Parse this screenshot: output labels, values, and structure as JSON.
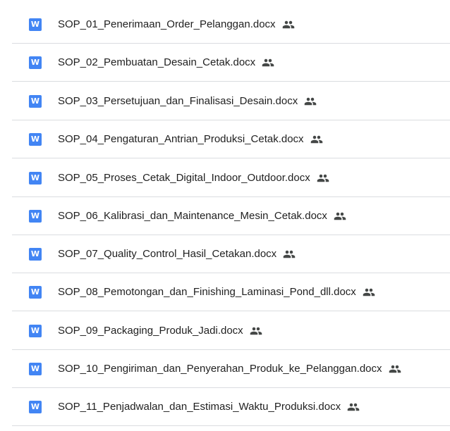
{
  "files": [
    {
      "name": "SOP_01_Penerimaan_Order_Pelanggan.docx",
      "type_icon": "word-doc-icon",
      "type_letter": "W",
      "shared": true
    },
    {
      "name": "SOP_02_Pembuatan_Desain_Cetak.docx",
      "type_icon": "word-doc-icon",
      "type_letter": "W",
      "shared": true
    },
    {
      "name": "SOP_03_Persetujuan_dan_Finalisasi_Desain.docx",
      "type_icon": "word-doc-icon",
      "type_letter": "W",
      "shared": true
    },
    {
      "name": "SOP_04_Pengaturan_Antrian_Produksi_Cetak.docx",
      "type_icon": "word-doc-icon",
      "type_letter": "W",
      "shared": true
    },
    {
      "name": "SOP_05_Proses_Cetak_Digital_Indoor_Outdoor.docx",
      "type_icon": "word-doc-icon",
      "type_letter": "W",
      "shared": true
    },
    {
      "name": "SOP_06_Kalibrasi_dan_Maintenance_Mesin_Cetak.docx",
      "type_icon": "word-doc-icon",
      "type_letter": "W",
      "shared": true
    },
    {
      "name": "SOP_07_Quality_Control_Hasil_Cetakan.docx",
      "type_icon": "word-doc-icon",
      "type_letter": "W",
      "shared": true
    },
    {
      "name": "SOP_08_Pemotongan_dan_Finishing_Laminasi_Pond_dll.docx",
      "type_icon": "word-doc-icon",
      "type_letter": "W",
      "shared": true
    },
    {
      "name": "SOP_09_Packaging_Produk_Jadi.docx",
      "type_icon": "word-doc-icon",
      "type_letter": "W",
      "shared": true
    },
    {
      "name": "SOP_10_Pengiriman_dan_Penyerahan_Produk_ke_Pelanggan.docx",
      "type_icon": "word-doc-icon",
      "type_letter": "W",
      "shared": true
    },
    {
      "name": "SOP_11_Penjadwalan_dan_Estimasi_Waktu_Produksi.docx",
      "type_icon": "word-doc-icon",
      "type_letter": "W",
      "shared": true
    }
  ],
  "colors": {
    "doc_icon": "#4285f4",
    "text": "#1f1f1f",
    "shared_icon": "#444746",
    "divider": "#dadce0"
  }
}
